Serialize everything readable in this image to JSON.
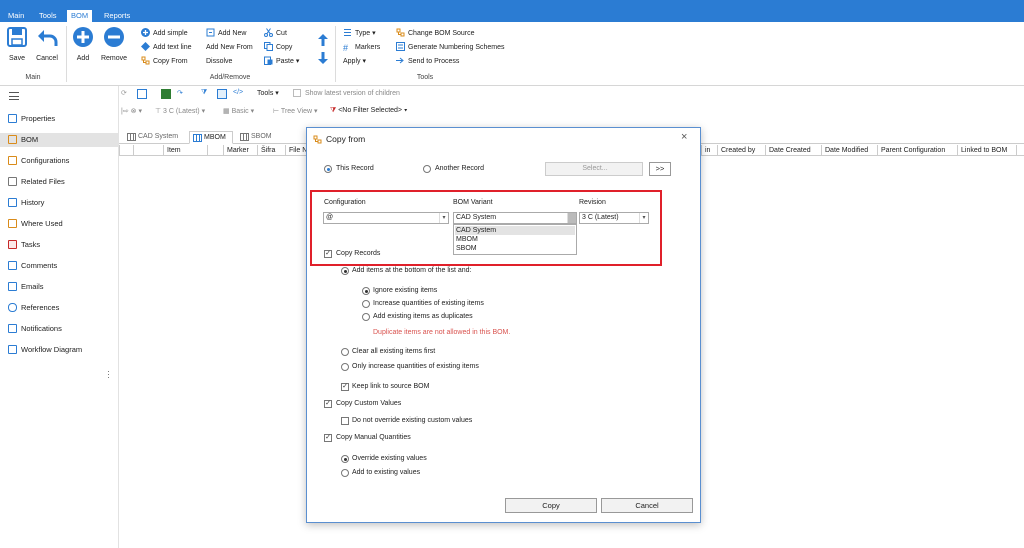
{
  "title_bar": {
    "text": "",
    "color": "#2b7cd3"
  },
  "ribbon_tabs": [
    "Main",
    "Tools",
    "BOM",
    "Reports"
  ],
  "ribbon": {
    "save": "Save",
    "cancel": "Cancel",
    "add": "Add",
    "remove": "Remove",
    "add_simple": "Add simple",
    "add_text_line": "Add text line",
    "copy_from": "Copy From",
    "add_new": "Add New",
    "add_new_from": "Add New From",
    "dissolve": "Dissolve",
    "cut": "Cut",
    "copy": "Copy",
    "paste": "Paste",
    "type": "Type",
    "markers": "Markers",
    "apply": "Apply",
    "change_bom_source": "Change BOM Source",
    "generate_numbering": "Generate Numbering Schemes",
    "send_to_process": "Send to Process",
    "group_main": "Main",
    "group_add_remove": "Add/Remove",
    "group_tools": "Tools"
  },
  "sidebar": {
    "items": [
      "Properties",
      "BOM",
      "Configurations",
      "Related Files",
      "History",
      "Where Used",
      "Tasks",
      "Comments",
      "Emails",
      "References",
      "Notifications",
      "Workflow Diagram"
    ],
    "selected": "BOM"
  },
  "toolbar": {
    "tools": "Tools",
    "show_latest": "Show latest version of children",
    "revision": "3  C (Latest)",
    "basic": "Basic",
    "tree_view": "Tree View",
    "filter": "<No Filter Selected>"
  },
  "doc_tabs": [
    "CAD System",
    "MBOM",
    "SBOM"
  ],
  "grid_columns": [
    "Item",
    "Marker",
    "Šifra",
    "File Na",
    "in",
    "Created by",
    "Date Created",
    "Date Modified",
    "Parent Configuration",
    "Linked to BOM"
  ],
  "dialog": {
    "title": "Copy from",
    "this_record": "This Record",
    "another_record": "Another Record",
    "select_placeholder": "Select...",
    "more_button": ">>",
    "config_label": "Configuration",
    "config_value": "@",
    "bom_variant_label": "BOM Variant",
    "bom_variant_value": "CAD System",
    "bom_variant_options": [
      "CAD System",
      "MBOM",
      "SBOM"
    ],
    "revision_label": "Revision",
    "revision_value": "3  C (Latest)",
    "copy_records": "Copy Records",
    "add_bottom": "Add items at the bottom of the list and:",
    "ignore_existing": "Ignore existing items",
    "increase_qty": "Increase quantities of existing items",
    "add_duplicates": "Add existing items as duplicates",
    "duplicate_warning": "Duplicate items are not allowed in this BOM.",
    "clear_all": "Clear all existing items first",
    "only_increase": "Only increase quantities of existing items",
    "keep_link": "Keep link to source BOM",
    "copy_custom": "Copy Custom Values",
    "no_override": "Do not override existing custom values",
    "copy_manual": "Copy Manual Quantities",
    "override_values": "Override existing values",
    "add_existing_values": "Add to existing values",
    "copy_button": "Copy",
    "cancel_button": "Cancel"
  },
  "colors": {
    "accent": "#2b7cd3",
    "highlight_border": "#e0202a",
    "warning_text": "#d9534f"
  }
}
